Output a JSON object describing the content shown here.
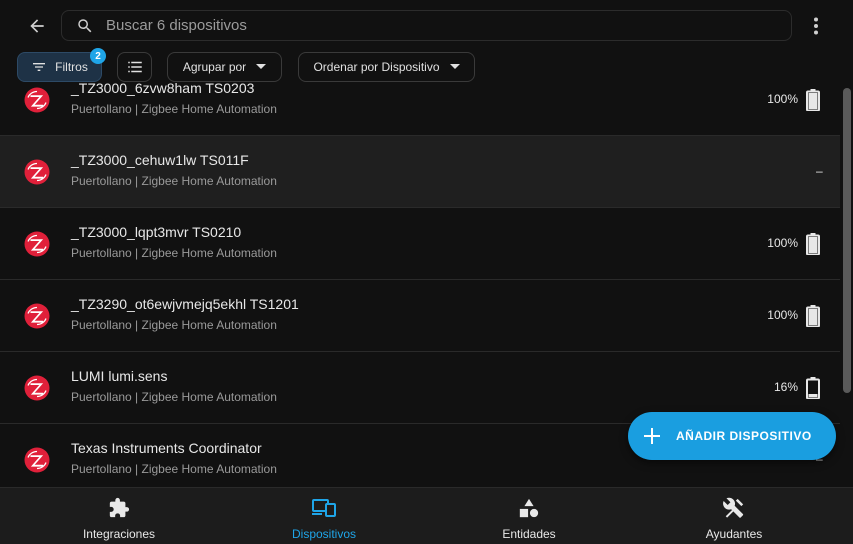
{
  "search": {
    "placeholder": "Buscar 6 dispositivos",
    "value": ""
  },
  "filters": {
    "filters_label": "Filtros",
    "filters_count": "2",
    "group_by_label": "Agrupar por",
    "sort_by_label": "Ordenar por Dispositivo"
  },
  "devices": [
    {
      "name": "_TZ3000_6zvw8ham TS0203",
      "subtitle": "Puertollano | Zigbee Home Automation",
      "battery": "100%",
      "battery_level": 100
    },
    {
      "name": "_TZ3000_cehuw1lw TS011F",
      "subtitle": "Puertollano | Zigbee Home Automation",
      "battery": "–",
      "battery_level": null
    },
    {
      "name": "_TZ3000_lqpt3mvr TS0210",
      "subtitle": "Puertollano | Zigbee Home Automation",
      "battery": "100%",
      "battery_level": 100
    },
    {
      "name": "_TZ3290_ot6ewjvmejq5ekhl TS1201",
      "subtitle": "Puertollano | Zigbee Home Automation",
      "battery": "100%",
      "battery_level": 100
    },
    {
      "name": "LUMI lumi.sens",
      "subtitle": "Puertollano | Zigbee Home Automation",
      "battery": "16%",
      "battery_level": 16
    },
    {
      "name": "Texas Instruments Coordinator",
      "subtitle": "Puertollano | Zigbee Home Automation",
      "battery": "–",
      "battery_level": null
    }
  ],
  "fab": {
    "label": "AÑADIR DISPOSITIVO"
  },
  "bottom_nav": [
    {
      "label": "Integraciones",
      "icon": "puzzle-icon",
      "active": false
    },
    {
      "label": "Dispositivos",
      "icon": "devices-icon",
      "active": true
    },
    {
      "label": "Entidades",
      "icon": "shapes-icon",
      "active": false
    },
    {
      "label": "Ayudantes",
      "icon": "tools-icon",
      "active": false
    }
  ],
  "colors": {
    "accent": "#1fa5e8",
    "background": "#111111",
    "zigbee_red": "#e0203a",
    "nav_background": "#1c1c1c"
  }
}
